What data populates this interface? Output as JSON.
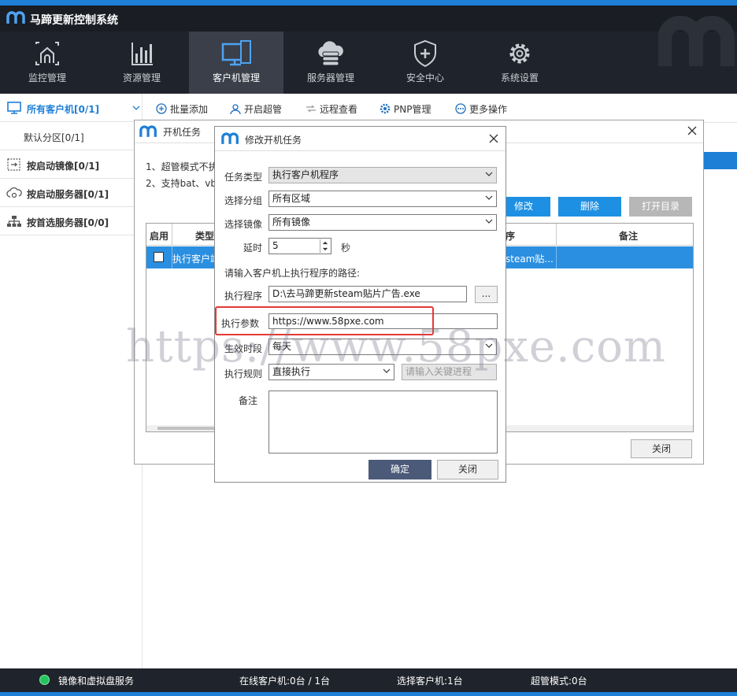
{
  "app": {
    "title": "马蹄更新控制系统"
  },
  "nav": [
    {
      "label": "监控管理",
      "icon": "home-monitor-icon"
    },
    {
      "label": "资源管理",
      "icon": "bar-chart-icon"
    },
    {
      "label": "客户机管理",
      "icon": "monitor-icon"
    },
    {
      "label": "服务器管理",
      "icon": "cloud-server-icon"
    },
    {
      "label": "安全中心",
      "icon": "shield-icon"
    },
    {
      "label": "系统设置",
      "icon": "gear-icon"
    }
  ],
  "sidebar": {
    "items": [
      {
        "label": "所有客户机[0/1]",
        "icon": "monitor-icon"
      },
      {
        "label": "默认分区[0/1]"
      },
      {
        "label": "按启动镜像[0/1]",
        "icon": "image-icon"
      },
      {
        "label": "按启动服务器[0/1]",
        "icon": "cloud-icon"
      },
      {
        "label": "按首选服务器[0/0]",
        "icon": "network-icon"
      }
    ]
  },
  "toolbar": {
    "batch_add": "批量添加",
    "super": "开启超管",
    "remote": "远程查看",
    "pnp": "PNP管理",
    "more": "更多操作"
  },
  "boot_dialog": {
    "title": "开机任务",
    "note1": "1、超管模式不执",
    "note2": "2、支持bat、vb",
    "buttons": {
      "edit": "修改",
      "delete": "删除",
      "open_dir": "打开目录",
      "close": "关闭"
    },
    "table": {
      "headers": [
        "启用",
        "类型",
        "序",
        "备注"
      ],
      "row": {
        "type": "执行客户端",
        "program": "steam贴...",
        "note": ""
      }
    }
  },
  "edit_dialog": {
    "title": "修改开机任务",
    "task_type_label": "任务类型",
    "task_type": "执行客户机程序",
    "group_label": "选择分组",
    "group": "所有区域",
    "image_label": "选择镜像",
    "image": "所有镜像",
    "delay_label": "延时",
    "delay": "5",
    "delay_unit": "秒",
    "path_hint": "请输入客户机上执行程序的路径:",
    "program_label": "执行程序",
    "program": "D:\\去马蹄更新steam贴片广告.exe",
    "browse": "...",
    "params_label": "执行参数",
    "params": "https://www.58pxe.com",
    "period_label": "生效时段",
    "period": "每天",
    "rule_label": "执行规则",
    "rule": "直接执行",
    "keyword_placeholder": "请输入关键进程",
    "note_label": "备注",
    "ok": "确定",
    "close": "关闭"
  },
  "watermark": "https://www.58pxe.com",
  "status": {
    "service": "镜像和虚拟盘服务",
    "online": "在线客户机:0台 / 1台",
    "selected": "选择客户机:1台",
    "super": "超管模式:0台"
  },
  "colors": {
    "accent": "#1e90e3",
    "nav_bg": "#1f232b",
    "active_nav": "#3a3f4a",
    "highlight_red": "#e53935",
    "status_green": "#22c55e"
  }
}
